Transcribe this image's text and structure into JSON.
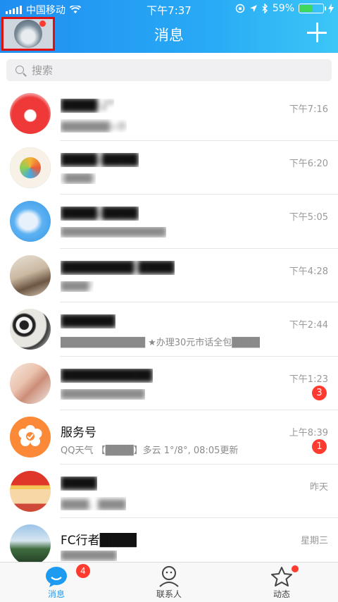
{
  "status_bar": {
    "carrier": "中国移动",
    "time": "下午7:37",
    "battery_percent": "59%",
    "battery_level": 0.59
  },
  "header": {
    "title": "消息"
  },
  "search": {
    "placeholder": "搜索"
  },
  "conversations": [
    {
      "name": "████·♪\"",
      "preview": "███████+群",
      "time": "下午7:16",
      "badge": ""
    },
    {
      "name": "████-████",
      "preview": "[████]",
      "time": "下午6:20",
      "badge": ""
    },
    {
      "name": "████-████",
      "preview": "███████████████",
      "time": "下午5:05",
      "badge": ""
    },
    {
      "name": "████████·████",
      "preview": "████?",
      "time": "下午4:28",
      "badge": ""
    },
    {
      "name": "██████",
      "preview": "████████████ ★办理30元市话全包████",
      "time": "下午2:44",
      "badge": ""
    },
    {
      "name": "██████████",
      "preview": "████████████",
      "time": "下午1:23",
      "badge": "3"
    },
    {
      "name": "服务号",
      "preview": "QQ天气 【████】多云 1°/8°, 08:05更新",
      "time": "上午8:39",
      "badge": "1"
    },
    {
      "name": "████",
      "preview": "████，████",
      "time": "昨天",
      "badge": ""
    },
    {
      "name": "FC行者████",
      "preview": "████████",
      "time": "星期三",
      "badge": ""
    }
  ],
  "tabbar": {
    "messages_label": "消息",
    "messages_badge": "4",
    "contacts_label": "联系人",
    "moments_label": "动态"
  },
  "colors": {
    "header_start": "#1f8ef1",
    "header_end": "#3cc6f7",
    "badge": "#ff3b30",
    "active_tab": "#1d9bf0"
  }
}
